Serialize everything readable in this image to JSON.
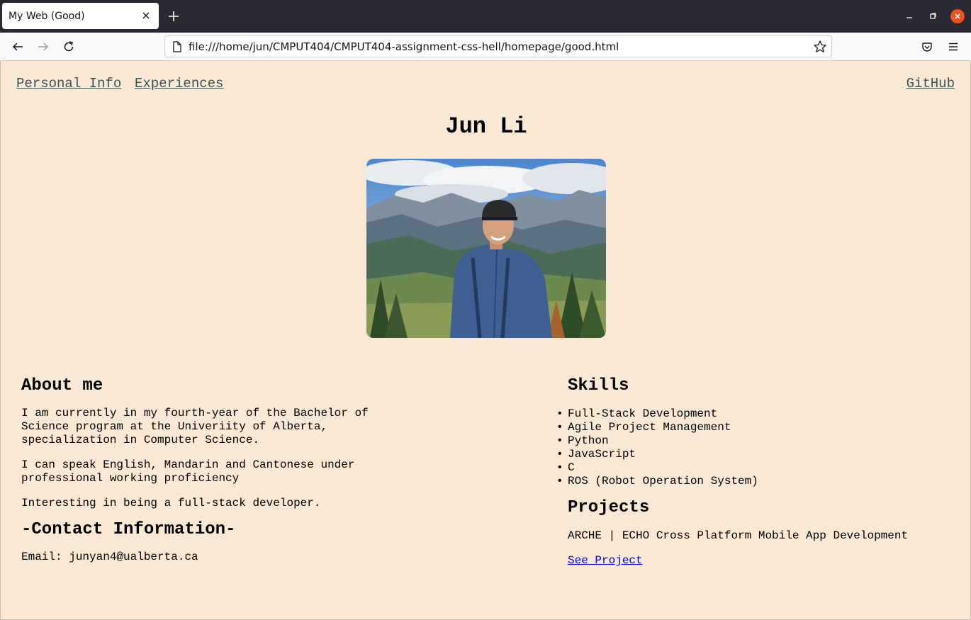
{
  "browser": {
    "tab_title": "My Web (Good)",
    "url": "file:///home/jun/CMPUT404/CMPUT404-assignment-css-hell/homepage/good.html"
  },
  "nav": {
    "personal_info": "Personal Info",
    "experiences": "Experiences",
    "github": "GitHub"
  },
  "profile": {
    "name": "Jun Li"
  },
  "about": {
    "heading": "About me",
    "paragraphs": [
      "I am currently in my fourth-year of the Bachelor of Science program at the Univeriity of Alberta, specialization in Computer Science.",
      "I can speak English, Mandarin and Cantonese under professional working proficiency",
      "Interesting in being a full-stack developer."
    ]
  },
  "contact": {
    "heading": "-Contact Information-",
    "email": "Email: junyan4@ualberta.ca"
  },
  "skills": {
    "heading": "Skills",
    "items": [
      "Full-Stack Development",
      "Agile Project Management",
      "Python",
      "JavaScript",
      "C",
      "ROS (Robot Operation System)"
    ]
  },
  "projects": {
    "heading": "Projects",
    "item": "ARCHE | ECHO Cross Platform Mobile App Development",
    "link": "See Project"
  }
}
